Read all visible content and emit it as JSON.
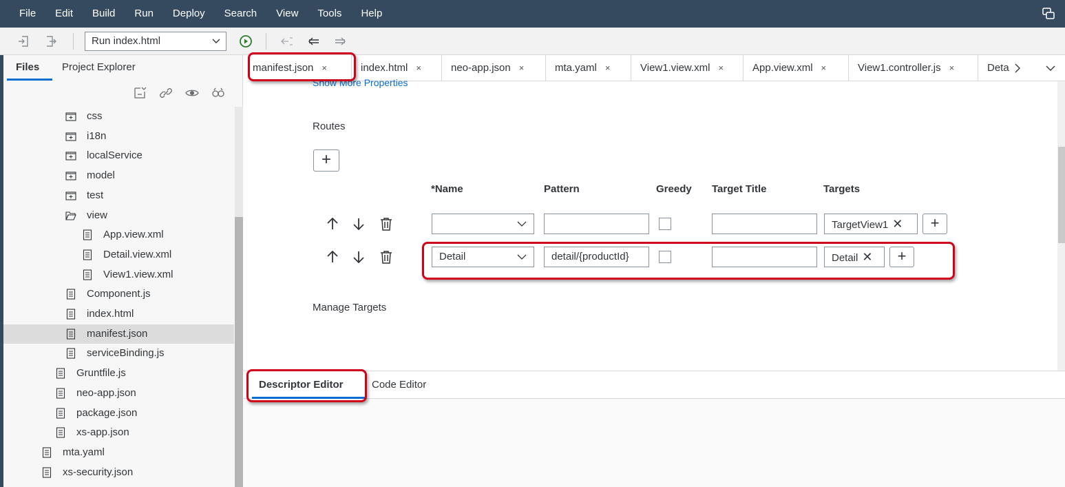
{
  "menubar": {
    "items": [
      "File",
      "Edit",
      "Build",
      "Run",
      "Deploy",
      "Search",
      "View",
      "Tools",
      "Help"
    ],
    "collab_icon": "collaboration-icon"
  },
  "toolbar": {
    "run_config": "Run index.html",
    "icons": [
      "import-icon",
      "export-icon",
      "run-icon",
      "jump-back-icon",
      "arrow-left-icon",
      "arrow-right-icon"
    ]
  },
  "left_panel": {
    "tabs": [
      "Files",
      "Project Explorer"
    ],
    "tools": [
      "collapse-all-icon",
      "link-icon",
      "show-hidden-icon",
      "search-icon"
    ],
    "tree": [
      {
        "name": "css",
        "type": "folder"
      },
      {
        "name": "i18n",
        "type": "folder"
      },
      {
        "name": "localService",
        "type": "folder"
      },
      {
        "name": "model",
        "type": "folder"
      },
      {
        "name": "test",
        "type": "folder"
      },
      {
        "name": "view",
        "type": "folder-open"
      },
      {
        "name": "App.view.xml",
        "type": "file"
      },
      {
        "name": "Detail.view.xml",
        "type": "file"
      },
      {
        "name": "View1.view.xml",
        "type": "file"
      },
      {
        "name": "Component.js",
        "type": "file"
      },
      {
        "name": "index.html",
        "type": "file"
      },
      {
        "name": "manifest.json",
        "type": "file",
        "selected": true
      },
      {
        "name": "serviceBinding.js",
        "type": "file"
      },
      {
        "name": "Gruntfile.js",
        "type": "file"
      },
      {
        "name": "neo-app.json",
        "type": "file"
      },
      {
        "name": "package.json",
        "type": "file"
      },
      {
        "name": "xs-app.json",
        "type": "file"
      },
      {
        "name": "mta.yaml",
        "type": "file"
      },
      {
        "name": "xs-security.json",
        "type": "file"
      }
    ]
  },
  "editor_tabs": {
    "tabs": [
      "manifest.json",
      "index.html",
      "neo-app.json",
      "mta.yaml",
      "View1.view.xml",
      "App.view.xml",
      "View1.controller.js",
      "Deta"
    ],
    "close_glyph": "×"
  },
  "editor": {
    "show_more": "Show More Properties",
    "routes_title": "Routes",
    "add_route": "+",
    "columns": [
      "*Name",
      "Pattern",
      "Greedy",
      "Target Title",
      "Targets"
    ],
    "routes": [
      {
        "name": "",
        "pattern": "",
        "greedy": false,
        "target_title": "",
        "targets": [
          "TargetView1"
        ]
      },
      {
        "name": "Detail",
        "pattern": "detail/{productId}",
        "greedy": false,
        "target_title": "",
        "targets": [
          "Detail"
        ]
      }
    ],
    "manage_targets": "Manage Targets",
    "plus": "+",
    "token_remove": "✕"
  },
  "bottom_tabs": {
    "descriptor": "Descriptor Editor",
    "code": "Code Editor"
  },
  "colors": {
    "shell": "#354a5f",
    "accent": "#0a6ed1",
    "highlight": "#d0021b"
  }
}
